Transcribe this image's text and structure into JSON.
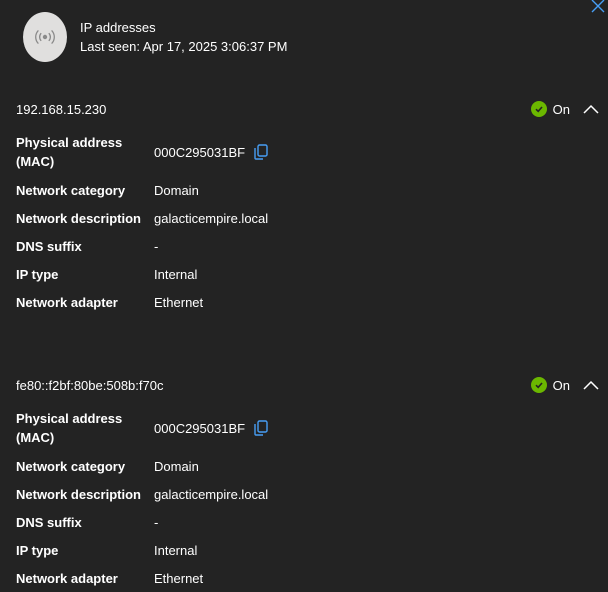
{
  "header": {
    "title": "IP addresses",
    "last_seen": "Last seen: Apr 17, 2025 3:06:37 PM"
  },
  "ip_entries": [
    {
      "address": "192.168.15.230",
      "status": "On",
      "details": [
        {
          "label": "Physical address (MAC)",
          "value": "000C295031BF"
        },
        {
          "label": "Network category",
          "value": "Domain"
        },
        {
          "label": "Network description",
          "value": "galacticempire.local"
        },
        {
          "label": "DNS suffix",
          "value": "-"
        },
        {
          "label": "IP type",
          "value": "Internal"
        },
        {
          "label": "Network adapter",
          "value": "Ethernet"
        }
      ]
    },
    {
      "address": "fe80::f2bf:80be:508b:f70c",
      "status": "On",
      "details": [
        {
          "label": "Physical address (MAC)",
          "value": "000C295031BF"
        },
        {
          "label": "Network category",
          "value": "Domain"
        },
        {
          "label": "Network description",
          "value": "galacticempire.local"
        },
        {
          "label": "DNS suffix",
          "value": "-"
        },
        {
          "label": "IP type",
          "value": "Internal"
        },
        {
          "label": "Network adapter",
          "value": "Ethernet"
        }
      ]
    }
  ],
  "icons": {
    "close": "close-icon",
    "avatar": "broadcast-icon",
    "status": "checkmark-circle-icon",
    "collapse": "chevron-up-icon",
    "copy": "copy-icon"
  },
  "colors": {
    "background": "#232323",
    "text": "#ffffff",
    "accent": "#479ef5",
    "status_ok": "#6bb700"
  }
}
